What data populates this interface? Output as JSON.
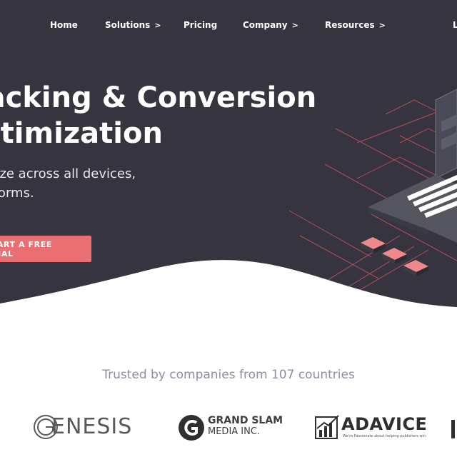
{
  "nav": {
    "items": [
      {
        "label": "Home",
        "has_chevron": false
      },
      {
        "label": "Solutions",
        "has_chevron": true
      },
      {
        "label": "Pricing",
        "has_chevron": false
      },
      {
        "label": "Company",
        "has_chevron": true
      },
      {
        "label": "Resources",
        "has_chevron": true
      },
      {
        "label": "L",
        "has_chevron": false
      }
    ],
    "chevron_glyph": ">"
  },
  "hero": {
    "headline_line1": "Tracking & Conversion",
    "headline_line2": "Optimization",
    "subtitle_line1": "Track and optimize across all devices,",
    "subtitle_line2": "channels & platforms.",
    "cta_label": "START A FREE TRIAL",
    "background_color": "#35343f",
    "accent_color": "#ea6f72"
  },
  "trusted": {
    "text": "Trusted by companies from 107 countries"
  },
  "logos": [
    {
      "name": "genesis",
      "text": "ENESIS"
    },
    {
      "name": "grand-slam",
      "line1": "GRAND SLAM",
      "line2": "MEDIA INC."
    },
    {
      "name": "adavice",
      "text": "ADAVICE",
      "tagline": "We're Passionate about helping publishers win"
    }
  ]
}
